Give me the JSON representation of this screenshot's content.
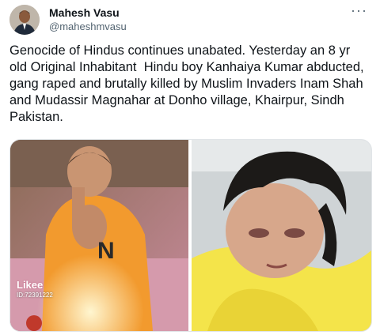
{
  "author": {
    "name": "Mahesh Vasu",
    "handle": "@maheshmvasu",
    "avatar_icon": "user-avatar-icon"
  },
  "more_icon": "more-dots-icon",
  "more_label": "···",
  "tweet": {
    "text": "Genocide of Hindus continues unabated. Yesterday an 8 yr old Original Inhabitant  Hindu boy Kanhaiya Kumar abducted, gang raped and brutally killed by Muslim Invaders Inam Shah and Mudassir Magnahar at Donho village, Khairpur, Sindh Pakistan."
  },
  "media": {
    "left_watermark": "Likee",
    "left_watermark_id": "ID:72391222"
  }
}
